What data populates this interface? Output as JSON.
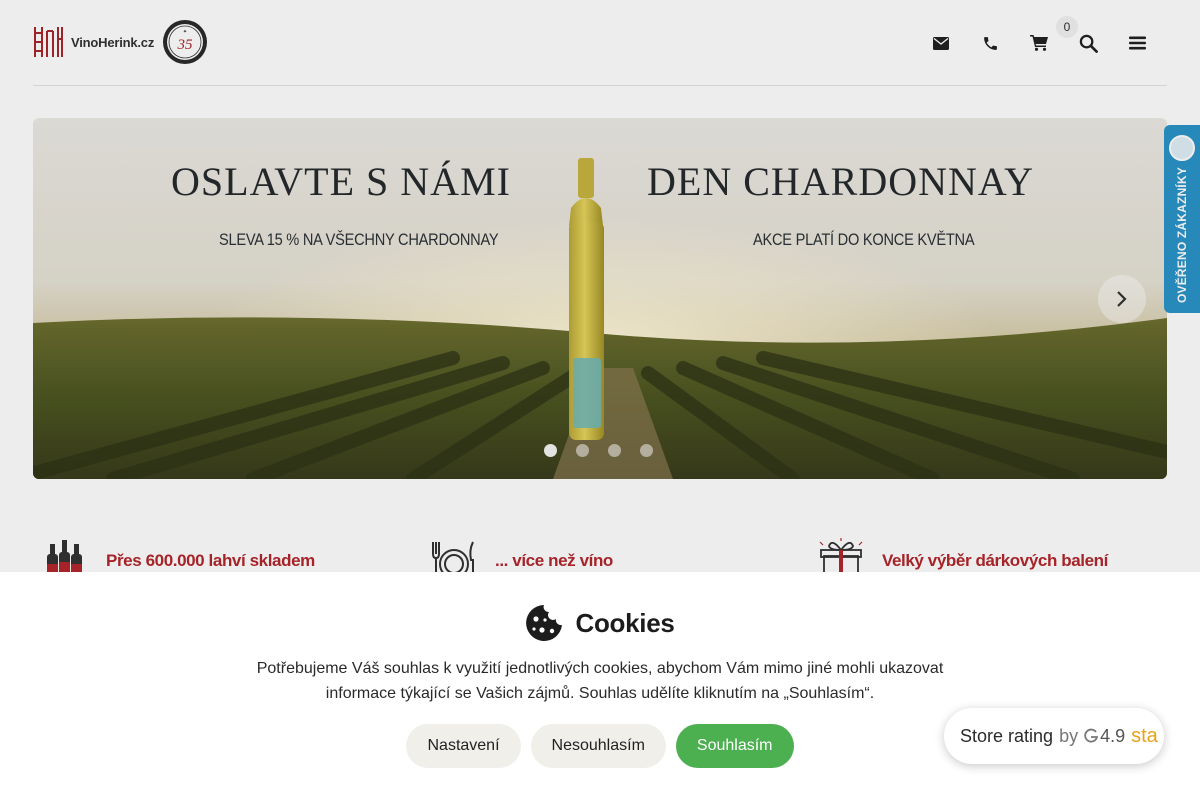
{
  "header": {
    "logo_text": "VinoHerink.cz",
    "badge_number": "35",
    "cart_count": "0",
    "icons": [
      "envelope-icon",
      "phone-icon",
      "cart-icon",
      "search-icon",
      "menu-icon"
    ]
  },
  "banner": {
    "title_left": "OSLAVTE S NÁMI",
    "title_right": "DEN CHARDONNAY",
    "subtitle_left": "SLEVA 15 % NA VŠECHNY CHARDONNAY",
    "subtitle_right": "AKCE PLATÍ DO KONCE KVĚTNA",
    "slide_count": 4,
    "active_slide": 1
  },
  "verified_tab": {
    "label": "OVĚŘENO ZÁKAZNÍKY"
  },
  "features": [
    {
      "icon": "wine-bottles-icon",
      "text": "Přes 600.000 lahví skladem"
    },
    {
      "icon": "cutlery-plate-icon",
      "text": "... více než víno"
    },
    {
      "icon": "gift-icon",
      "text": "Velký výběr dárkových balení"
    }
  ],
  "cookies": {
    "title": "Cookies",
    "text_line1": "Potřebujeme Váš souhlas k využití jednotlivých cookies, abychom Vám mimo jiné mohli ukazovat",
    "text_line2": "informace týkající se Vašich zájmů. Souhlas udělíte kliknutím na „Souhlasím“.",
    "settings_label": "Nastavení",
    "decline_label": "Nesouhlasím",
    "accept_label": "Souhlasím"
  },
  "rating_widget": {
    "label": "Store rating",
    "by": "by",
    "score": "4.9",
    "stars_text": "sta"
  },
  "colors": {
    "brand_red": "#b3272d",
    "accept_green": "#4caf50",
    "verified_blue": "#2a94c8"
  }
}
